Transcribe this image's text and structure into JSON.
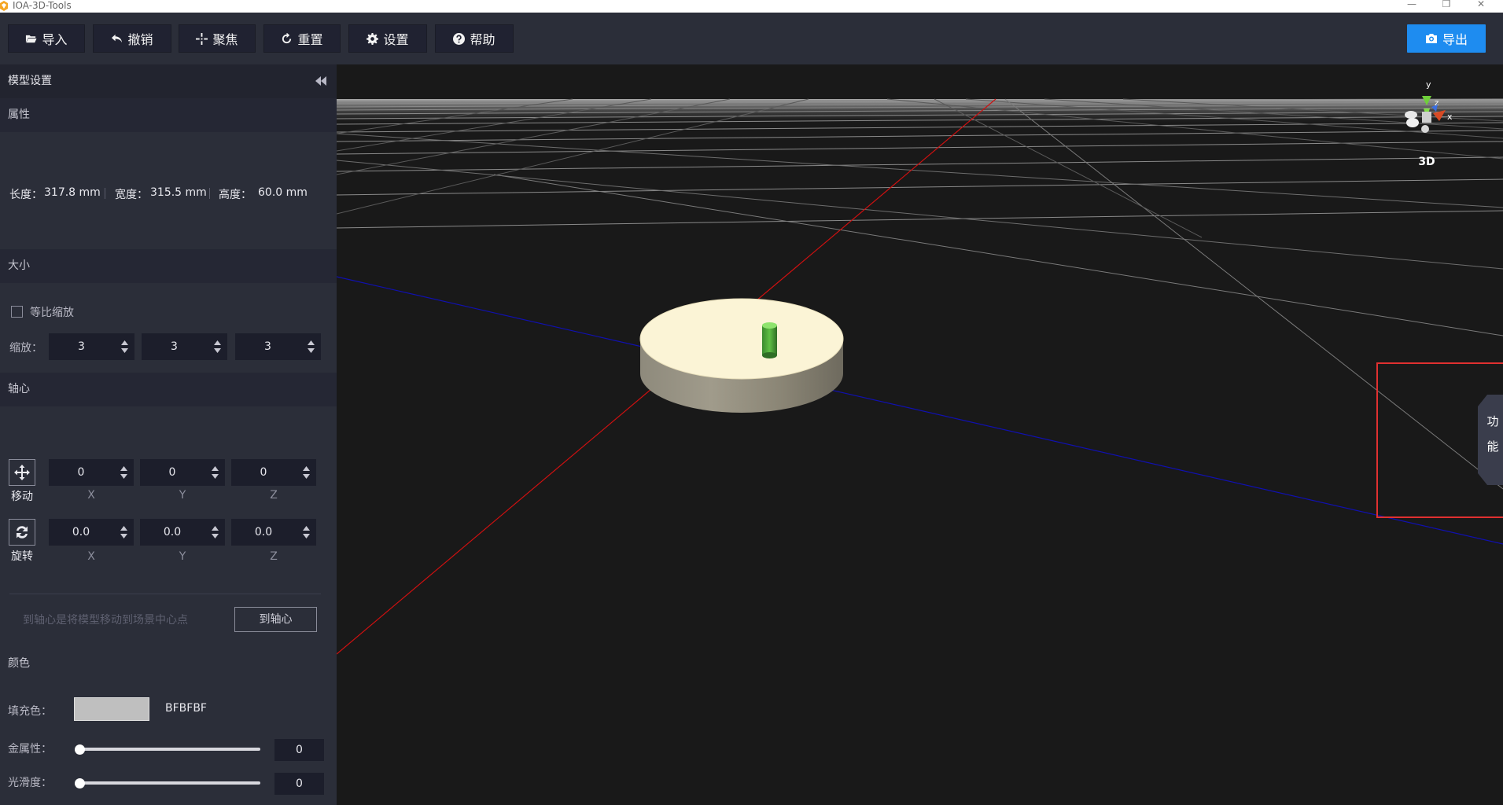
{
  "window": {
    "title": "IOA-3D-Tools",
    "controls": [
      "—",
      "❐",
      "✕"
    ]
  },
  "toolbar": {
    "buttons": [
      {
        "label": "导入",
        "icon": "folder-open-icon"
      },
      {
        "label": "撤销",
        "icon": "undo-icon"
      },
      {
        "label": "聚焦",
        "icon": "crosshair-icon"
      },
      {
        "label": "重置",
        "icon": "refresh-icon"
      },
      {
        "label": "设置",
        "icon": "gear-icon"
      },
      {
        "label": "帮助",
        "icon": "help-icon"
      }
    ],
    "export": {
      "label": "导出",
      "icon": "camera-icon"
    }
  },
  "sidebar": {
    "title": "模型设置",
    "properties": {
      "header": "属性",
      "length_label": "长度：",
      "length_value": "317.8 mm",
      "width_label": "宽度：",
      "width_value": "315.5 mm",
      "height_label": "高度：",
      "height_value": "60.0 mm"
    },
    "size": {
      "header": "大小",
      "uniform_scale_label": "等比缩放",
      "uniform_scale_checked": false,
      "scale_label": "缩放：",
      "scale_values": [
        "3",
        "3",
        "3"
      ]
    },
    "pivot": {
      "header": "轴心",
      "move_label": "移动",
      "move_values": [
        "0",
        "0",
        "0"
      ],
      "rotate_label": "旋转",
      "rotate_values": [
        "0.0",
        "0.0",
        "0.0"
      ],
      "axes": [
        "X",
        "Y",
        "Z"
      ],
      "hint": "到轴心是将模型移动到场景中心点",
      "to_pivot_button": "到轴心"
    },
    "color": {
      "header": "颜色",
      "fill_label": "填充色：",
      "fill_hex": "BFBFBF",
      "fill_color": "#bfbfbf",
      "metalness_label": "金属性：",
      "metalness_value": "0",
      "smoothness_label": "光滑度：",
      "smoothness_value": "0"
    }
  },
  "viewport": {
    "view_mode": "3D",
    "gizmo_axes": {
      "y": "y",
      "z": "z",
      "x": "x"
    },
    "function_tab": [
      "功",
      "能"
    ],
    "axis_colors": {
      "x_line": "#d01010",
      "z_line": "#1010b0",
      "grid": "#8a8a8a"
    }
  }
}
